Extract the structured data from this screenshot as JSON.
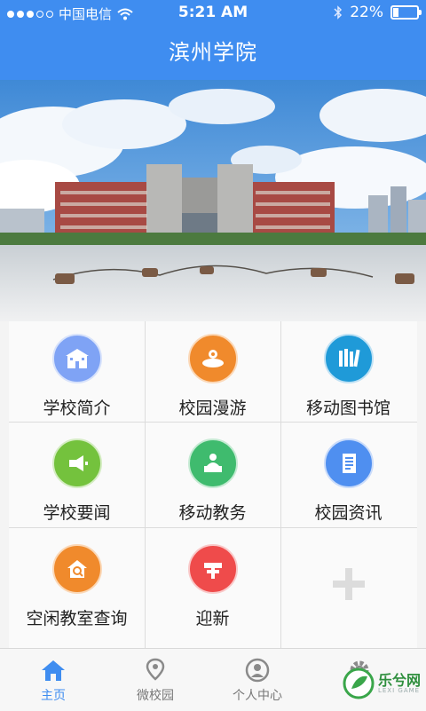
{
  "status": {
    "carrier": "中国电信",
    "time": "5:21 AM",
    "battery": "22%",
    "battery_level": 0.22,
    "signal_strength": "3 of 5"
  },
  "header": {
    "title": "滨州学院"
  },
  "banner": {
    "image": "campus-building-photo"
  },
  "menu": {
    "items": [
      {
        "label": "学校简介",
        "icon": "school-building-icon",
        "color": "#7fa3f5"
      },
      {
        "label": "校园漫游",
        "icon": "campus-tour-icon",
        "color": "#f08a2c"
      },
      {
        "label": "移动图书馆",
        "icon": "library-books-icon",
        "color": "#1f9ad8"
      },
      {
        "label": "学校要闻",
        "icon": "megaphone-icon",
        "color": "#74c23d"
      },
      {
        "label": "移动教务",
        "icon": "teacher-desk-icon",
        "color": "#3fbb6e"
      },
      {
        "label": "校园资讯",
        "icon": "news-document-icon",
        "color": "#4f8ff0"
      },
      {
        "label": "空闲教室查询",
        "icon": "classroom-search-icon",
        "color": "#f08a2c"
      },
      {
        "label": "迎新",
        "icon": "signpost-icon",
        "color": "#ef4b4b"
      }
    ],
    "add_icon": "plus-icon"
  },
  "tabbar": {
    "tabs": [
      {
        "label": "主页",
        "icon": "home-icon",
        "active": true
      },
      {
        "label": "微校园",
        "icon": "map-pin-icon",
        "active": false
      },
      {
        "label": "个人中心",
        "icon": "user-icon",
        "active": false
      },
      {
        "label": "",
        "icon": "gear-icon",
        "active": false
      }
    ]
  },
  "watermark": {
    "text": "乐兮网",
    "sub": "LEXI GAME"
  },
  "colors": {
    "accent": "#3f8df0"
  }
}
